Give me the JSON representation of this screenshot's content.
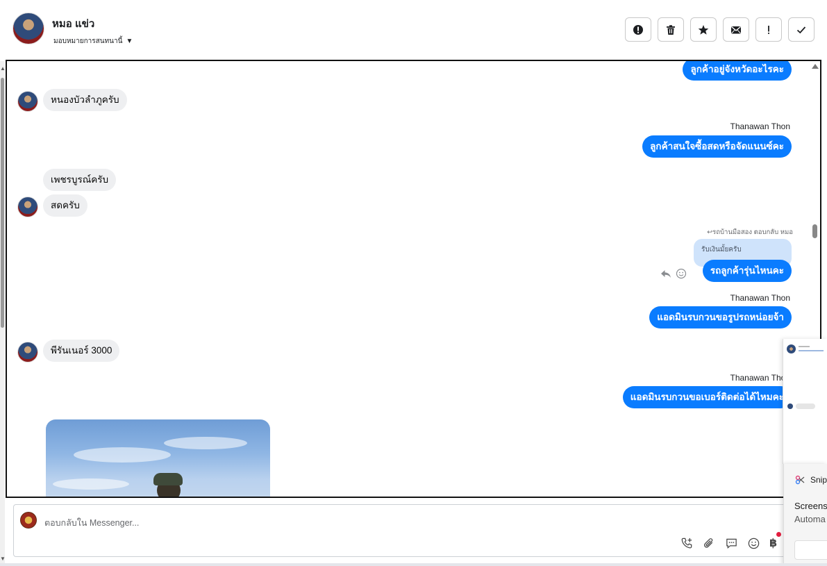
{
  "header": {
    "contact_name": "หมอ แข่ว",
    "assign_label": "มอบหมายการสนทนานี้"
  },
  "toolbar": {
    "buttons": [
      "alert-circle-icon",
      "trash-icon",
      "star-icon",
      "mail-icon",
      "exclamation-icon",
      "check-icon"
    ]
  },
  "messages": {
    "m1_out": "ลูกค้าอยู่จังหวัดอะไรคะ",
    "m2_in": "หนองบัวลำภูครับ",
    "m3_sender": "Thanawan Thon",
    "m3_out": "ลูกค้าสนใจซื้อสดหรือจัดแนนซ์คะ",
    "m4_in": "เพชรบูรณ์ครับ",
    "m5_in": "สดครับ",
    "m6_reply_meta": "รถบ้านมือสอง ตอบกลับ หมอ",
    "m6_quoted": "รับเงินมั้ยครับ",
    "m6_out": "รถลูกค้ารุ่นไหนคะ",
    "m7_sender": "Thanawan Thon",
    "m7_out": "แอดมินรบกวนขอรูปรถหน่อยจ้า",
    "m8_in": "พีรันเนอร์ 3000",
    "m9_sender": "Thanawan Thon",
    "m9_out": "แอดมินรบกวนขอเบอร์ติดต่อได้ไหมคะ"
  },
  "composer": {
    "placeholder": "ตอบกลับใน Messenger..."
  },
  "snip": {
    "title": "Snip",
    "line1": "Screens",
    "line2": "Automa"
  },
  "colors": {
    "outgoing_bubble": "#0a7cff",
    "incoming_bubble": "#eeeff1",
    "quoted_bubble": "#cfe3fb"
  }
}
